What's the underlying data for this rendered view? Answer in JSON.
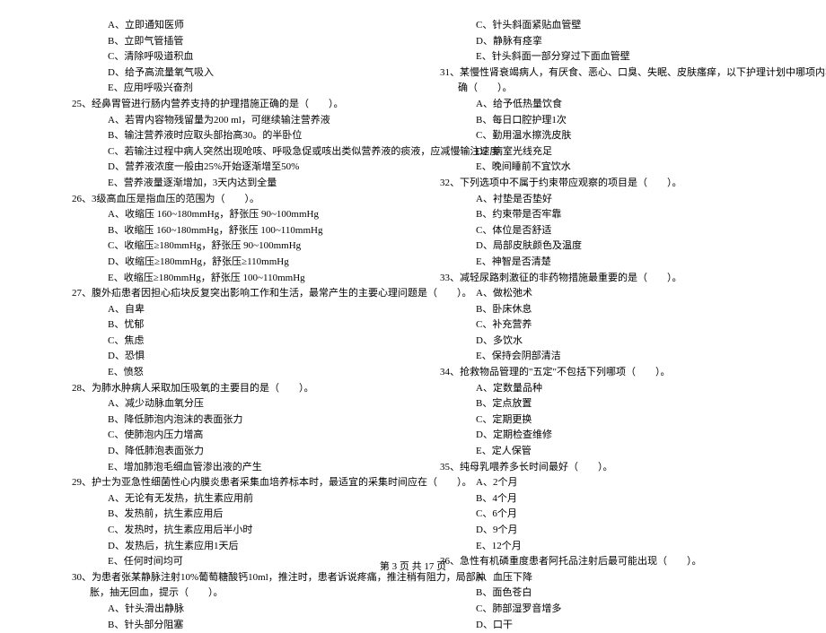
{
  "left": {
    "pre_options": [
      "A、立即通知医师",
      "B、立即气管插管",
      "C、清除呼吸道积血",
      "D、给予高流量氧气吸入",
      "E、应用呼吸兴奋剂"
    ],
    "q25": {
      "stem": "25、经鼻胃管进行肠内营养支持的护理措施正确的是（　　）。",
      "opts": [
        "A、若胃内容物残留量为200 ml，可继续输注营养液",
        "B、输注营养液时应取头部抬高30。的半卧位",
        "C、若输注过程中病人突然出现呛咳、呼吸急促或咳出类似营养液的痰液，应减慢输注速度",
        "D、营养液浓度一般由25%开始逐渐增至50%",
        "E、营养液量逐渐增加，3天内达到全量"
      ]
    },
    "q26": {
      "stem": "26、3级高血压是指血压的范围为（　　）。",
      "opts": [
        "A、收缩压 160~180mmHg，舒张压 90~100mmHg",
        "B、收缩压 160~180mmHg，舒张压 100~110mmHg",
        "C、收缩压≥180mmHg，舒张压 90~100mmHg",
        "D、收缩压≥180mmHg，舒张压≥110mmHg",
        "E、收缩压≥180mmHg，舒张压 100~110mmHg"
      ]
    },
    "q27": {
      "stem": "27、腹外疝患者因担心疝块反复突出影响工作和生活，最常产生的主要心理问题是（　　）。",
      "opts": [
        "A、自卑",
        "B、忧郁",
        "C、焦虑",
        "D、恐惧",
        "E、愤怒"
      ]
    },
    "q28": {
      "stem": "28、为肺水肿病人采取加压吸氧的主要目的是（　　）。",
      "opts": [
        "A、减少动脉血氧分压",
        "B、降低肺泡内泡沫的表面张力",
        "C、使肺泡内压力增高",
        "D、降低肺泡表面张力",
        "E、增加肺泡毛细血管渗出液的产生"
      ]
    },
    "q29": {
      "stem": "29、护士为亚急性细菌性心内膜炎患者采集血培养标本时，最适宜的采集时间应在（　　）。",
      "opts": [
        "A、无论有无发热，抗生素应用前",
        "B、发热前，抗生素应用后",
        "C、发热时，抗生素应用后半小时",
        "D、发热后，抗生素应用1天后",
        "E、任何时间均可"
      ]
    },
    "q30": {
      "stem1": "30、为患者张某静脉注射10%葡萄糖酸钙10ml，推注时，患者诉说疼痛，推注稍有阻力，局部肿",
      "stem2": "胀，抽无回血，提示（　　）。",
      "opts": [
        "A、针头滑出静脉",
        "B、针头部分阻塞"
      ]
    }
  },
  "right": {
    "pre_options": [
      "C、针头斜面紧贴血管壁",
      "D、静脉有痉挛",
      "E、针头斜面一部分穿过下面血管壁"
    ],
    "q31": {
      "stem1": "31、某慢性肾衰竭病人，有厌食、恶心、口臭、失眠、皮肤瘙痒，以下护理计划中哪项内容正",
      "stem2": "确（　　）。",
      "opts": [
        "A、给予低热量饮食",
        "B、每日口腔护理1次",
        "C、勤用温水擦洗皮肤",
        "D、病室光线充足",
        "E、晚间睡前不宜饮水"
      ]
    },
    "q32": {
      "stem": "32、下列选项中不属于约束带应观察的项目是（　　）。",
      "opts": [
        "A、衬垫是否垫好",
        "B、约束带是否牢靠",
        "C、体位是否舒适",
        "D、局部皮肤颜色及温度",
        "E、神智是否清楚"
      ]
    },
    "q33": {
      "stem": "33、减轻尿路刺激征的非药物措施最重要的是（　　）。",
      "opts": [
        "A、做松弛术",
        "B、卧床休息",
        "C、补充营养",
        "D、多饮水",
        "E、保持会阴部清洁"
      ]
    },
    "q34": {
      "stem": "34、抢救物品管理的\"五定\"不包括下列哪项（　　）。",
      "opts": [
        "A、定数量品种",
        "B、定点放置",
        "C、定期更换",
        "D、定期检查维修",
        "E、定人保管"
      ]
    },
    "q35": {
      "stem": "35、纯母乳喂养多长时间最好（　　）。",
      "opts": [
        "A、2个月",
        "B、4个月",
        "C、6个月",
        "D、9个月",
        "E、12个月"
      ]
    },
    "q36": {
      "stem": "36、急性有机磷重度患者阿托品注射后最可能出现（　　）。",
      "opts": [
        "A、血压下降",
        "B、面色苍白",
        "C、肺部湿罗音增多",
        "D、口干"
      ]
    }
  },
  "footer": "第 3 页 共 17 页"
}
